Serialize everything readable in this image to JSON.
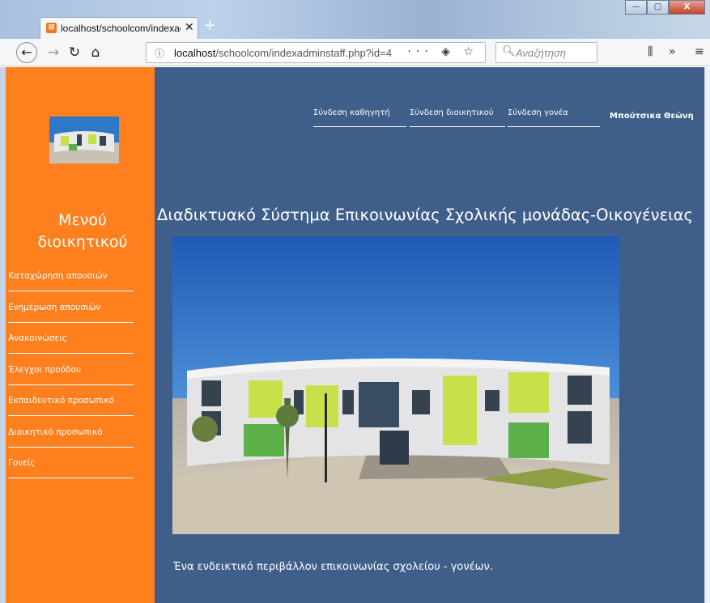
{
  "browser": {
    "tab_title": "localhost/schoolcom/indexadm",
    "tab_close": "✕",
    "new_tab": "+",
    "url_host": "localhost",
    "url_path": "/schoolcom/indexadminstaff.php?id=4",
    "url_actions": "··· ◈ ☆",
    "search_placeholder": "Αναζήτηση",
    "win_buttons": [
      "—",
      "▢",
      "X"
    ]
  },
  "sidebar": {
    "title": "Μενού διοικητικού",
    "items": [
      {
        "label": "Καταχώρηση απουσιών"
      },
      {
        "label": "Ενημέρωση απουσιών"
      },
      {
        "label": "Ανακοινώσεις"
      },
      {
        "label": "Έλεγχοι προόδου"
      },
      {
        "label": "Εκπαιδευτικό προσωπικό"
      },
      {
        "label": "Διοικητικό προσωπικό"
      },
      {
        "label": "Γονείς"
      }
    ]
  },
  "topnav": {
    "items": [
      {
        "label": "Σύνδεση καθηγητή"
      },
      {
        "label": "Σύνδεση διοικητικού"
      },
      {
        "label": "Σύνδεση γονέα"
      }
    ],
    "user": "Μπούτσικα Θεώνη"
  },
  "main": {
    "title": "Διαδικτυακό Σύστημα Επικοινωνίας Σχολικής μονάδας-Οικογένειας",
    "caption": "Ένα ενδεικτικό περιβάλλον επικοινωνίας σχολείου - γονέων."
  },
  "colors": {
    "sidebar": "#fe7f1e",
    "content": "#3f5f8a",
    "text": "#ffffff"
  }
}
